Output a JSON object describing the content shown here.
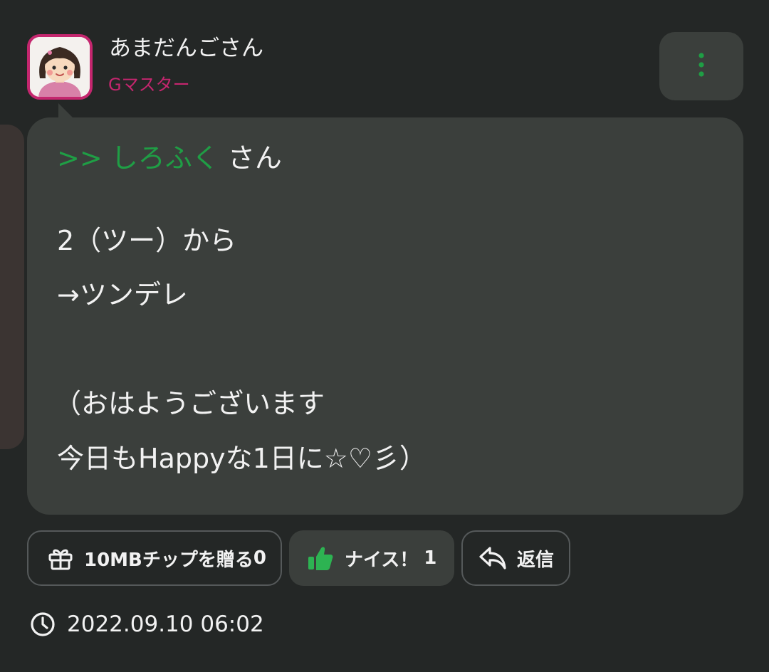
{
  "post": {
    "author_name": "あまだんごさん",
    "author_rank": "Gマスター",
    "more_icon": "more-vertical-icon",
    "reply_to": {
      "prefix": ">>",
      "name": "しろふく",
      "honorific": "さん"
    },
    "body_lines": [
      "2（ツー）から",
      "→ツンデレ",
      "（おはようございます",
      "今日もHappyな1日に☆♡彡）"
    ]
  },
  "actions": {
    "gift_label": "10MBチップを贈る",
    "gift_count": "0",
    "gift_icon": "gift-icon",
    "nice_label": "ナイス！",
    "nice_count": "1",
    "nice_icon": "thumbs-up-icon",
    "reply_label": "返信",
    "reply_icon": "reply-icon"
  },
  "timestamp": {
    "icon": "clock-icon",
    "value": "2022.09.10 06:02"
  },
  "colors": {
    "background": "#242726",
    "bubble": "#3b3f3c",
    "accent_green": "#1f9e45",
    "rank_pink": "#c4266e"
  }
}
